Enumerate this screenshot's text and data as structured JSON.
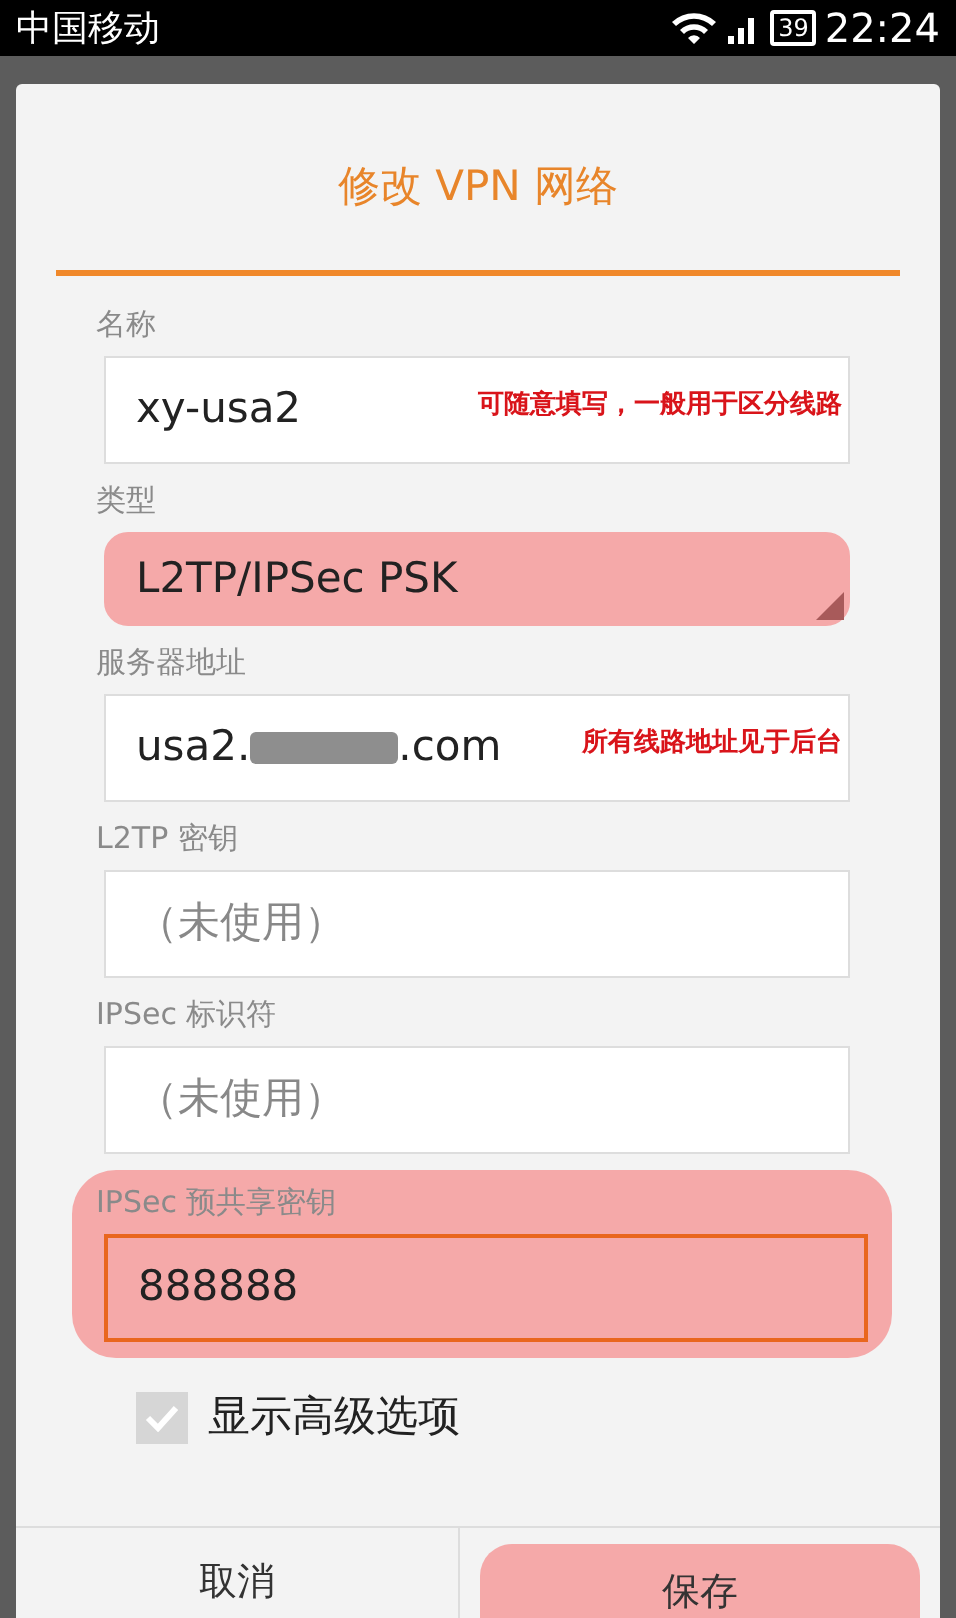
{
  "status_bar": {
    "carrier": "中国移动",
    "battery": "39",
    "time": "22:24"
  },
  "dialog": {
    "title": "修改 VPN 网络",
    "fields": [
      {
        "kind": "text",
        "label": "名称",
        "value": "xy-usa2",
        "hint": "可随意填写，一般用于区分线路"
      },
      {
        "kind": "select",
        "label": "类型",
        "value": "L2TP/IPSec PSK",
        "highlighted": true
      },
      {
        "kind": "redacted",
        "label": "服务器地址",
        "value": "usa2.",
        "value_end": ".com",
        "hint": "所有线路地址见于后台"
      },
      {
        "kind": "text",
        "label": "L2TP 密钥",
        "placeholder": "（未使用）"
      },
      {
        "kind": "text",
        "label": "IPSec 标识符",
        "placeholder": "（未使用）"
      },
      {
        "kind": "text",
        "label": "IPSec 预共享密钥",
        "value": "888888",
        "highlighted": true
      }
    ],
    "advanced": {
      "label": "显示高级选项",
      "checked": true
    },
    "buttons": [
      {
        "label": "取消",
        "highlighted": false
      },
      {
        "label": "保存",
        "highlighted": true
      }
    ]
  }
}
